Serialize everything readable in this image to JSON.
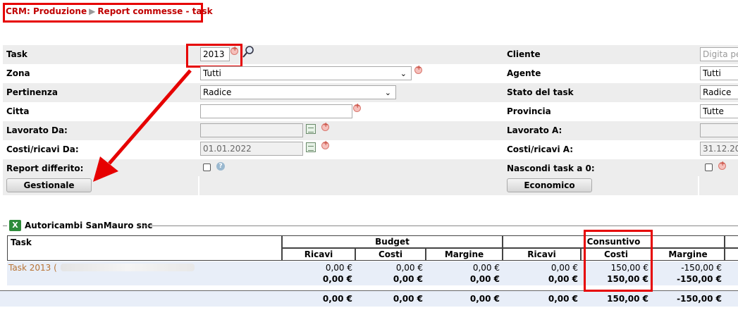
{
  "breadcrumb": {
    "section": "CRM: Produzione",
    "page": "Report commesse - task",
    "separator": "▶"
  },
  "form": {
    "task": {
      "label": "Task",
      "value": "2013"
    },
    "zona": {
      "label": "Zona",
      "value": "Tutti"
    },
    "pertinenza": {
      "label": "Pertinenza",
      "value": "Radice"
    },
    "citta": {
      "label": "Citta",
      "value": ""
    },
    "lavorato_da": {
      "label": "Lavorato Da:",
      "value": ""
    },
    "costi_da": {
      "label": "Costi/ricavi Da:",
      "value": "01.01.2022"
    },
    "report_differito": {
      "label": "Report differito:"
    },
    "cliente": {
      "label": "Cliente",
      "placeholder": "Digita pe"
    },
    "agente": {
      "label": "Agente",
      "value": "Tutti"
    },
    "stato": {
      "label": "Stato del task",
      "value": "Radice"
    },
    "provincia": {
      "label": "Provincia",
      "value": "Tutte"
    },
    "lavorato_a": {
      "label": "Lavorato A:",
      "value": ""
    },
    "costi_a": {
      "label": "Costi/ricavi A:",
      "value": "31.12.20"
    },
    "nascondi": {
      "label": "Nascondi task a 0:"
    }
  },
  "buttons": {
    "gestionale": "Gestionale",
    "economico": "Economico"
  },
  "report": {
    "title": "Autoricambi SanMauro snc",
    "headers": {
      "task": "Task",
      "budget": "Budget",
      "consuntivo": "Consuntivo",
      "ricavi": "Ricavi",
      "costi": "Costi",
      "margine": "Margine"
    },
    "row": {
      "task": "Task 2013 (",
      "budget_ricavi": "0,00 €",
      "budget_costi": "0,00 €",
      "budget_margine": "0,00 €",
      "cons_ricavi": "0,00 €",
      "cons_costi": "150,00 €",
      "cons_margine": "-150,00 €"
    },
    "subtotal": {
      "budget_ricavi": "0,00 €",
      "budget_costi": "0,00 €",
      "budget_margine": "0,00 €",
      "cons_ricavi": "0,00 €",
      "cons_costi": "150,00 €",
      "cons_margine": "-150,00 €"
    },
    "total": {
      "budget_ricavi": "0,00 €",
      "budget_costi": "0,00 €",
      "budget_margine": "0,00 €",
      "cons_ricavi": "0,00 €",
      "cons_costi": "150,00 €",
      "cons_margine": "-150,00 €"
    }
  },
  "colors": {
    "accent_red": "#e60000",
    "breadcrumb": "#c00000",
    "alt_row": "#ededed",
    "data_row": "#e8eef8"
  }
}
